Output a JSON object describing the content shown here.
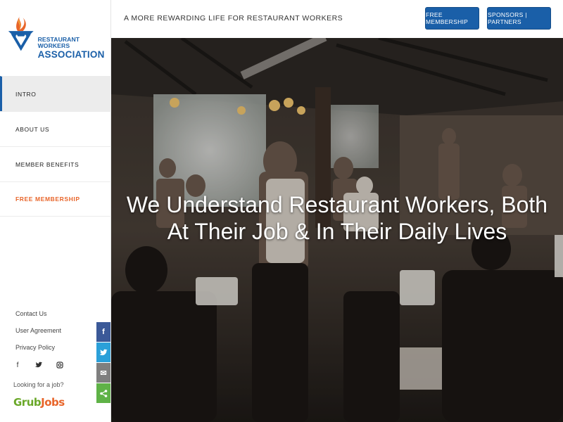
{
  "brand": {
    "logo_line1": "RESTAURANT WORKERS",
    "logo_line2": "ASSOCIATION",
    "primary_color": "#1a5fa8",
    "accent_color": "#e8652a"
  },
  "header": {
    "tagline": "A MORE REWARDING LIFE FOR RESTAURANT WORKERS",
    "free_membership_label": "FREE MEMBERSHIP",
    "sponsors_label": "SPONSORS | PARTNERS"
  },
  "sidebar": {
    "items": [
      {
        "label": "INTRO",
        "active": true
      },
      {
        "label": "ABOUT US",
        "active": false
      },
      {
        "label": "MEMBER BENEFITS",
        "active": false
      },
      {
        "label": "FREE MEMBERSHIP",
        "active": false,
        "highlight": true
      }
    ],
    "footer_links": [
      "Contact Us",
      "User Agreement",
      "Privacy Policy"
    ],
    "social_icons": [
      "facebook-icon",
      "twitter-icon",
      "instagram-icon"
    ],
    "job_question": "Looking for a job?",
    "grubjobs_part1": "Grub",
    "grubjobs_part2": "Jobs"
  },
  "hero": {
    "title_line1": "We Understand Restaurant Workers, Both",
    "title_line2": "At Their Job & In Their Daily Lives"
  },
  "share_bar": {
    "facebook": "f",
    "twitter": "t",
    "email": "✉",
    "share": "⤴"
  }
}
